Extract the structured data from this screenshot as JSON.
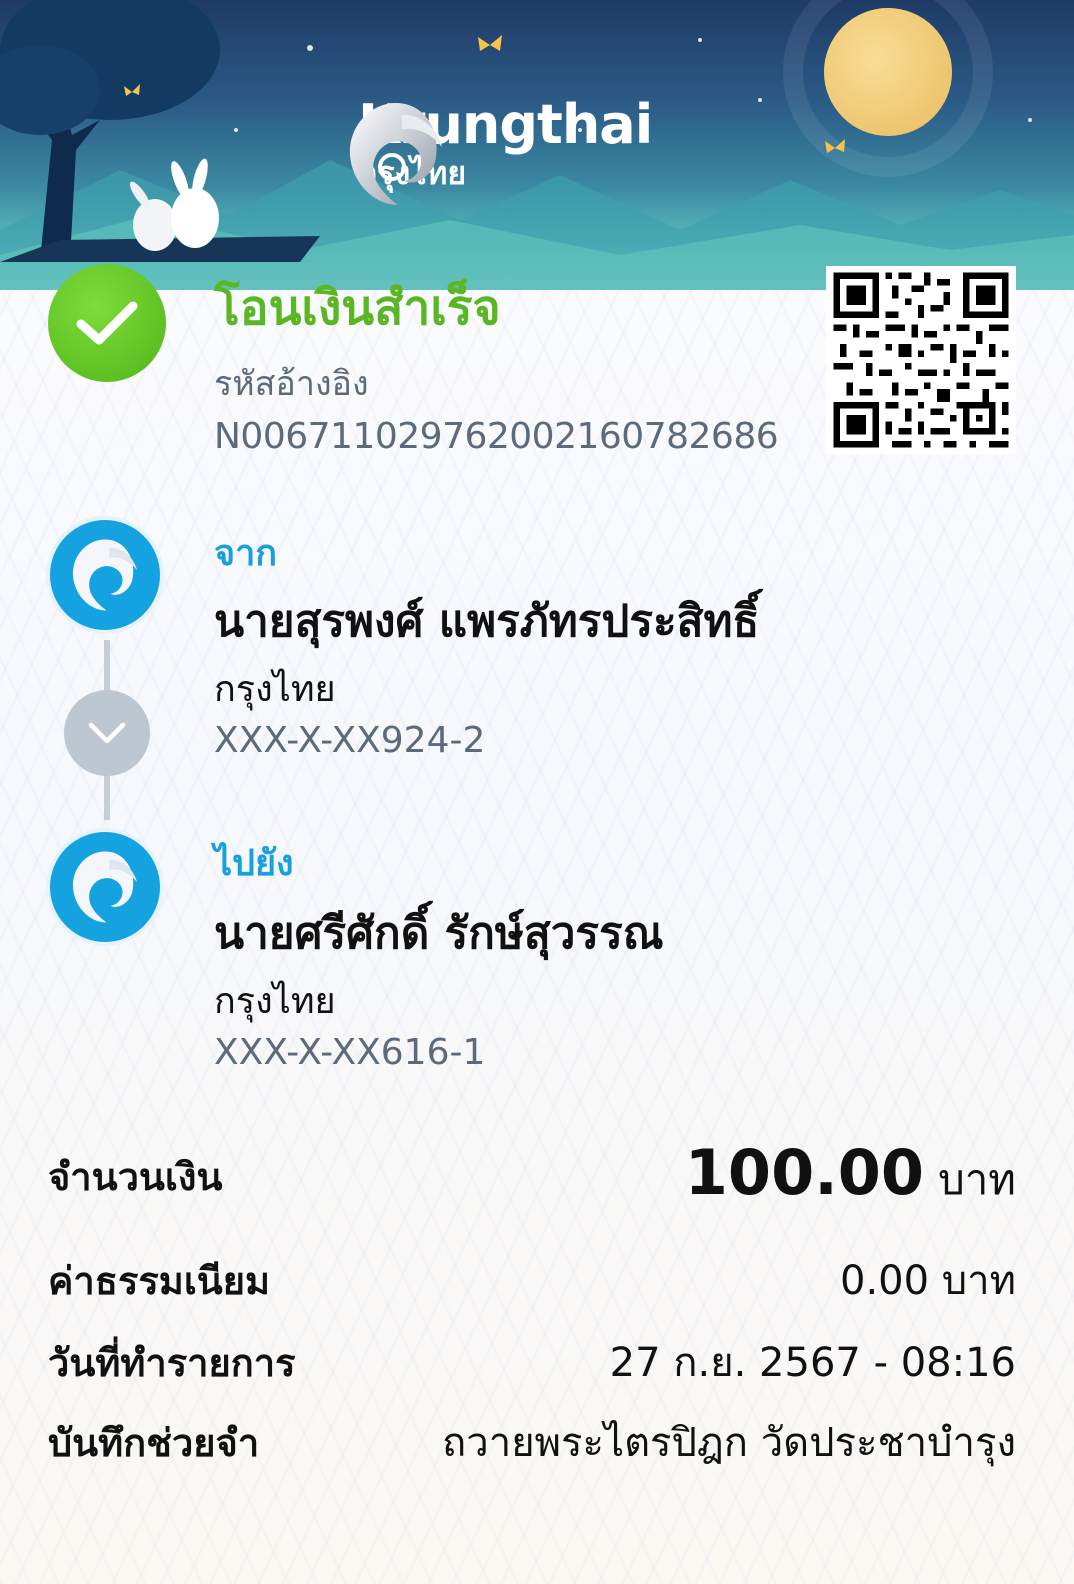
{
  "header": {
    "brand_en": "Krungthai",
    "brand_th": "กรุงไทย"
  },
  "status": {
    "title": "โอนเงินสำเร็จ",
    "ref_label": "รหัสอ้างอิง",
    "ref_value": "N006711029762002160782686"
  },
  "from": {
    "label": "จาก",
    "name": "นายสุรพงศ์ แพรภัทรประสิทธิ์",
    "bank": "กรุงไทย",
    "account": "XXX-X-XX924-2"
  },
  "to": {
    "label": "ไปยัง",
    "name": "นายศรีศักดิ์ รักษ์สุวรรณ",
    "bank": "กรุงไทย",
    "account": "XXX-X-XX616-1"
  },
  "details": {
    "amount_label": "จำนวนเงิน",
    "amount_value": "100.00",
    "amount_unit": "บาท",
    "fee_label": "ค่าธรรมเนียม",
    "fee_value": "0.00 บาท",
    "date_label": "วันที่ทำรายการ",
    "date_value": "27 ก.ย. 2567 - 08:16",
    "memo_label": "บันทึกช่วยจำ",
    "memo_value": "ถวายพระไตรปิฎก วัดประชาบำรุง"
  },
  "colors": {
    "success_green": "#5bb624",
    "accent_blue": "#18a0dc",
    "muted_text": "#5c6a7a"
  },
  "icons": {
    "status": "check-icon",
    "bank": "krungthai-bird-logo",
    "connector": "chevron-down-icon"
  }
}
